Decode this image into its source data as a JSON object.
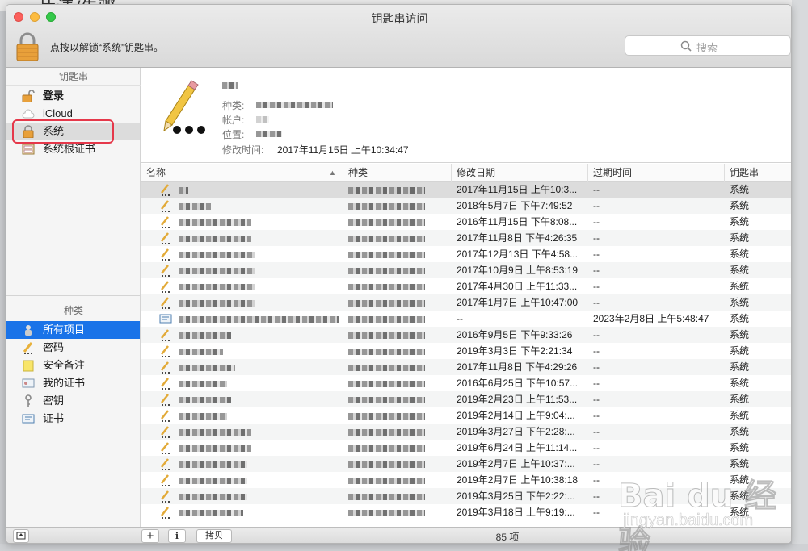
{
  "background": {
    "partial_title": "片渍/先骤"
  },
  "window": {
    "title": "钥匙串访问"
  },
  "toolbar": {
    "lock_text": "点按以解锁“系统”钥匙串。",
    "search_placeholder": "搜索"
  },
  "sidebar": {
    "keychains_header": "钥匙串",
    "keychains": [
      {
        "label": "登录",
        "icon": "lock-open-icon"
      },
      {
        "label": "iCloud",
        "icon": "cloud-icon"
      },
      {
        "label": "系统",
        "icon": "lock-icon",
        "selected": true
      },
      {
        "label": "系统根证书",
        "icon": "certificate-cabinet-icon"
      }
    ],
    "category_header": "种类",
    "categories": [
      {
        "label": "所有项目",
        "icon": "all-items-icon",
        "selected": true
      },
      {
        "label": "密码",
        "icon": "pencil-icon"
      },
      {
        "label": "安全备注",
        "icon": "note-icon"
      },
      {
        "label": "我的证书",
        "icon": "my-certificate-icon"
      },
      {
        "label": "密钥",
        "icon": "key-icon"
      },
      {
        "label": "证书",
        "icon": "certificate-icon"
      }
    ]
  },
  "detail": {
    "kind_label": "种类:",
    "account_label": "帐户:",
    "where_label": "位置:",
    "modified_label": "修改时间:",
    "modified_value": "2017年11月15日 上午10:34:47"
  },
  "table": {
    "columns": [
      "名称",
      "种类",
      "修改日期",
      "过期时间",
      "钥匙串"
    ],
    "rows": [
      {
        "date": "2017年11月15日 上午10:3...",
        "expires": "--",
        "keychain": "系统",
        "icon": "pencil-icon"
      },
      {
        "date": "2018年5月7日 下午7:49:52",
        "expires": "--",
        "keychain": "系统",
        "icon": "pencil-icon"
      },
      {
        "date": "2016年11月15日 下午8:08...",
        "expires": "--",
        "keychain": "系统",
        "icon": "pencil-icon"
      },
      {
        "date": "2017年11月8日 下午4:26:35",
        "expires": "--",
        "keychain": "系统",
        "icon": "pencil-icon"
      },
      {
        "date": "2017年12月13日 下午4:58...",
        "expires": "--",
        "keychain": "系统",
        "icon": "pencil-icon"
      },
      {
        "date": "2017年10月9日 上午8:53:19",
        "expires": "--",
        "keychain": "系统",
        "icon": "pencil-icon"
      },
      {
        "date": "2017年4月30日 上午11:33...",
        "expires": "--",
        "keychain": "系统",
        "icon": "pencil-icon"
      },
      {
        "date": "2017年1月7日 上午10:47:00",
        "expires": "--",
        "keychain": "系统",
        "icon": "pencil-icon"
      },
      {
        "date": "--",
        "expires": "2023年2月8日 上午5:48:47",
        "keychain": "系统",
        "icon": "certificate-icon"
      },
      {
        "date": "2016年9月5日 下午9:33:26",
        "expires": "--",
        "keychain": "系统",
        "icon": "pencil-icon"
      },
      {
        "date": "2019年3月3日 下午2:21:34",
        "expires": "--",
        "keychain": "系统",
        "icon": "pencil-icon"
      },
      {
        "date": "2017年11月8日 下午4:29:26",
        "expires": "--",
        "keychain": "系统",
        "icon": "pencil-icon"
      },
      {
        "date": "2016年6月25日 下午10:57...",
        "expires": "--",
        "keychain": "系统",
        "icon": "pencil-icon"
      },
      {
        "date": "2019年2月23日 上午11:53...",
        "expires": "--",
        "keychain": "系统",
        "icon": "pencil-icon"
      },
      {
        "date": "2019年2月14日 上午9:04:...",
        "expires": "--",
        "keychain": "系统",
        "icon": "pencil-icon"
      },
      {
        "date": "2019年3月27日 下午2:28:...",
        "expires": "--",
        "keychain": "系统",
        "icon": "pencil-icon"
      },
      {
        "date": "2019年6月24日 上午11:14...",
        "expires": "--",
        "keychain": "系统",
        "icon": "pencil-icon"
      },
      {
        "date": "2019年2月7日 上午10:37:...",
        "expires": "--",
        "keychain": "系统",
        "icon": "pencil-icon"
      },
      {
        "date": "2019年2月7日 上午10:38:18",
        "expires": "--",
        "keychain": "系统",
        "icon": "pencil-icon"
      },
      {
        "date": "2019年3月25日 下午2:22:...",
        "expires": "--",
        "keychain": "系统",
        "icon": "pencil-icon"
      },
      {
        "date": "2019年3月18日 上午9:19:...",
        "expires": "--",
        "keychain": "系统",
        "icon": "pencil-icon"
      }
    ]
  },
  "bottombar": {
    "add_label": "+",
    "info_label": "i",
    "copy_label": "拷贝",
    "count": "85 项"
  },
  "watermark": {
    "text": "Bai du 经验",
    "sub": "jingyan.baidu.com"
  },
  "colors": {
    "selection_blue": "#1a73e8",
    "highlight_red": "#e5384a",
    "lock_gold": "#e8a03a"
  }
}
